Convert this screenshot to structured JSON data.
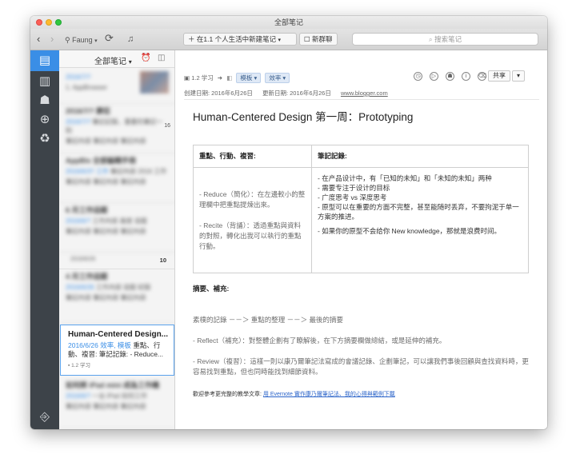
{
  "window": {
    "title": "全部笔记"
  },
  "toolbar": {
    "user": "Faung",
    "new_note": "在1.1 个人生活中新建笔记",
    "new_chat": "新群聊",
    "search_placeholder": "搜索笔记"
  },
  "sidebar": {
    "icons": [
      "notes-icon",
      "notebooks-icon",
      "tags-icon",
      "atlas-icon",
      "trash-icon"
    ],
    "bottom_icon": "switch-account-icon"
  },
  "note_list": {
    "header": "全部笔记",
    "blurred_notes": [
      {
        "title": "",
        "date": "2016/7/?",
        "snippet": "1. AppBrowser"
      },
      {
        "title": "2016/7/? 勝狂",
        "date": "2016/7/?",
        "snippet": "筆記記錄，重要的筆記一則"
      },
      {
        "title": "AppBlx 全部編輯手冊",
        "date": "2016/6/3? 工作",
        "snippet": "筆記內容 2016 工作"
      },
      {
        "title": "6 月工作追蹤",
        "date": "2016/6/?",
        "snippet": "工作內容 進度 追蹤"
      },
      {
        "title": "4 月工作追蹤",
        "date": "2016/6/26",
        "snippet": "工作內容 追蹤 紀錄"
      },
      {
        "title": "如何將 iPad mini 成為工作機",
        "date": "2016/6/?",
        "snippet": "一台 iPad 如何工作"
      }
    ],
    "counts": [
      "16",
      "10"
    ],
    "selected": {
      "title": "Human-Centered Design...",
      "date": "2016/6/26",
      "tags_inline": "效率, 模板",
      "snippet": "重點、行動、複習: 筆記記錄: - Reduce...",
      "notebook": "1.2 学习"
    }
  },
  "note": {
    "notebook": "1.2 学习",
    "tags": [
      "模板",
      "效率"
    ],
    "created_label": "创建日期: 2016年6月26日",
    "updated_label": "更新日期: 2016年6月26日",
    "source": "www.blogger.com",
    "share_label": "共享",
    "title": "Human-Centered Design 第一周：Prototyping",
    "table": {
      "col1_header": "重點、行動、複習:",
      "col2_header": "筆記記錄:",
      "col1_para1": "- Reduce（簡化）：在左邊較小的整理欄中把重點提煉出來。",
      "col1_para2": "- Recite（背誦）：透過重點與資料的對照，轉化出我可以執行的重點行動。",
      "col2_lines": [
        "- 在产品设计中，有「已知的未知」和「未知的未知」两种",
        "- 需要专注于设计的目标",
        "- 广度思考 vs 深度思考",
        "- 原型可以在重要的方面不完整，甚至能随时丢弃，不要拘泥于单一方案的推进。",
        "- 如果你的原型不会给你 New knowledge，那就是浪费时间。"
      ]
    },
    "summary_header": "摘要、補充:",
    "flow": "素樸的記錄 －－＞ 重點的整理 －－＞ 最後的摘要",
    "reflect": "- Reflect（補充）：對整體企劃有了瞭解後，在下方摘要欄做總結，或是延伸的補充。",
    "review": "- Review（複習）：這樣一則以康乃爾筆記法寫成的會議記錄、企劃筆記，可以讓我們事後回顧與查找資料時，更容易找到重點，但也同時能找到細節資料。",
    "footer_text": "歡迎參考更完整的教學文章:",
    "footer_link": "用 Evernote 實作康乃爾筆記法、我的心得與範例下載"
  }
}
